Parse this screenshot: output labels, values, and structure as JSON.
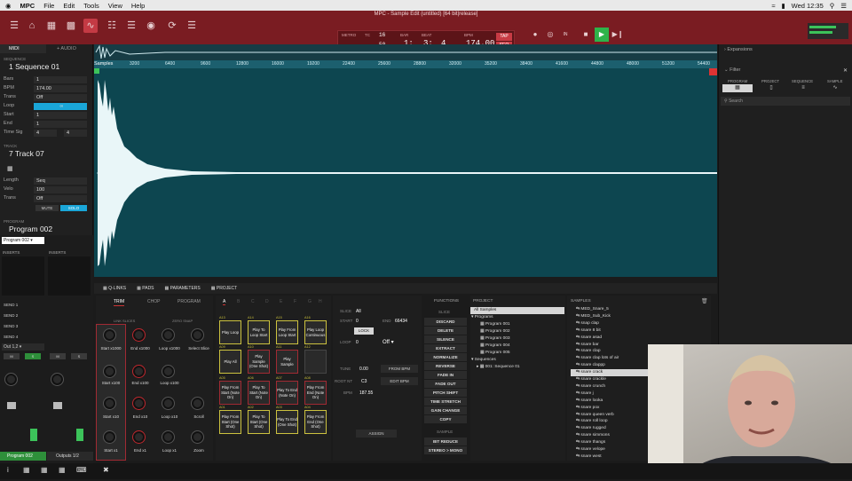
{
  "menubar": {
    "apple": "",
    "app": "MPC",
    "items": [
      "File",
      "Edit",
      "Tools",
      "View",
      "Help"
    ],
    "battery": "▮",
    "clock": "Wed 12:35"
  },
  "window_title": "MPC - Sample Edit (untitled) [64 bit|release]",
  "transport": {
    "metro_label": "METRO",
    "metro_val": "16",
    "tc_label": "TC",
    "tc_val": "16",
    "swing_label": "SWING",
    "swing_val": "50",
    "bar_label": "BAR",
    "bar_val": "1:",
    "beat_label": "BEAT",
    "beat_val": "3:",
    "tick_val": "4",
    "bpm_label": "BPM",
    "bpm_val": "174.00",
    "tap": "TAP",
    "seq": "SEQ",
    "in_label": "IN"
  },
  "left": {
    "midi_tab": "MIDI",
    "audio_tab": "+ AUDIO",
    "sequence_label": "SEQUENCE",
    "sequence_name": "1 Sequence 01",
    "fields": [
      {
        "k": "Bars",
        "v": "1"
      },
      {
        "k": "BPM",
        "v": "174.00"
      },
      {
        "k": "Trans",
        "v": "Off"
      },
      {
        "k": "Loop",
        "v": ""
      },
      {
        "k": "Start",
        "v": "1"
      },
      {
        "k": "End",
        "v": "1"
      },
      {
        "k": "Time Sig",
        "v": "4"
      }
    ],
    "time_sig_den": "4",
    "track_label": "TRACK",
    "track_name": "7 Track 07",
    "track_fields": [
      {
        "k": "Length",
        "v": "Seq"
      },
      {
        "k": "Velo",
        "v": "100"
      },
      {
        "k": "Trans",
        "v": "Off"
      }
    ],
    "mute": "MUTE",
    "solo": "SOLO",
    "program_label": "PROGRAM",
    "program_name": "Program 002",
    "program_select": "Program 002",
    "inserts": "INSERTS",
    "sends": [
      "SEND 1",
      "SEND 2",
      "SEND 3",
      "SEND 4"
    ],
    "out": "Out 1,2",
    "m_label": "M",
    "s_label": "S",
    "program_chip": "Program 002",
    "outputs_chip": "Outputs 1/2"
  },
  "ruler": {
    "first": "Samples",
    "ticks": [
      "3200",
      "6400",
      "9600",
      "12800",
      "16000",
      "19200",
      "22400",
      "25600",
      "28800",
      "32000",
      "35200",
      "38400",
      "41600",
      "44800",
      "48000",
      "51200",
      "54400"
    ]
  },
  "bottom_tabs": [
    "Q-LINKS",
    "PADS",
    "PARAMETERS",
    "PROJECT"
  ],
  "qlinks": {
    "tabs": [
      "TRIM",
      "CHOP",
      "PROGRAM"
    ],
    "link_slices": "LINK SLICES",
    "zero_snap": "ZERO SNAP",
    "knobs": [
      "Start x1000",
      "End x1000",
      "Loop x1000",
      "Select Slice",
      "Start x100",
      "End x100",
      "Loop x100",
      "",
      "Start x10",
      "End x10",
      "Loop x10",
      "Scroll",
      "Start x1",
      "End x1",
      "Loop x1",
      "Zoom"
    ]
  },
  "pads": {
    "banks": [
      "A",
      "B",
      "C",
      "D",
      "E",
      "F",
      "G",
      "H"
    ],
    "items": [
      {
        "n": "A13",
        "t": "Play Loop"
      },
      {
        "n": "A14",
        "t": "Play To Loop Start"
      },
      {
        "n": "A15",
        "t": "Play From Loop Start"
      },
      {
        "n": "A16",
        "t": "Play Loop Continuous"
      },
      {
        "n": "A09",
        "t": "Play All"
      },
      {
        "n": "A10",
        "t": "Play Sample (One Shot)"
      },
      {
        "n": "A11",
        "t": "Play Sample"
      },
      {
        "n": "A12",
        "t": ""
      },
      {
        "n": "A05",
        "t": "Play From Start (Note On)"
      },
      {
        "n": "A06",
        "t": "Play To Start (Note On)"
      },
      {
        "n": "A07",
        "t": "Play To End (Note On)"
      },
      {
        "n": "A08",
        "t": "Play From End (Note On)"
      },
      {
        "n": "A01",
        "t": "Play From Start (One Shot)"
      },
      {
        "n": "A02",
        "t": "Play To Start (One Shot)"
      },
      {
        "n": "A03",
        "t": "Play To End (One Shot)"
      },
      {
        "n": "A04",
        "t": "Play From End (One Shot)"
      }
    ]
  },
  "slice": {
    "slice_label": "SLICE",
    "slice_val": "All",
    "start_label": "START",
    "start_val": "0",
    "end_label": "END",
    "end_val": "66434",
    "lock": "LOCK",
    "loop_label": "LOOP",
    "loop_val": "0",
    "loop_mode": "Off",
    "tune_label": "TUNE",
    "tune_val": "0.00",
    "from_bpm": "FROM BPM",
    "root_label": "ROOT NT",
    "root_val": "C3",
    "edit_bpm": "EDIT BPM",
    "bpm_label": "BPM",
    "bpm_val": "187.55",
    "assign": "ASSIGN"
  },
  "functions": {
    "title": "FUNCTIONS",
    "slice_header": "SLICE",
    "items": [
      "DISCARD",
      "DELETE",
      "SILENCE",
      "EXTRACT",
      "NORMALIZE",
      "REVERSE",
      "FADE IN",
      "FADE OUT",
      "PITCH SHIFT",
      "TIME STRETCH",
      "GAIN CHANGE",
      "COPY"
    ],
    "sample_header": "SAMPLE",
    "sample_items": [
      "BIT REDUCE",
      "STEREO > MONO"
    ]
  },
  "project": {
    "title": "PROJECT",
    "all_samples": "All Samples",
    "programs": "Programs",
    "program_list": [
      "Program 001",
      "Program 002",
      "Program 003",
      "Program 004",
      "Program 005"
    ],
    "sequences": "Sequences",
    "sequence_list": [
      "001: Sequence 01"
    ]
  },
  "samples": {
    "title": "SAMPLES",
    "items": [
      "MED_Snare_5",
      "MED_Sub_Kick",
      "snap clap",
      "snare 8 bit",
      "snare asad",
      "snare bar",
      "snare clap",
      "snare clap lots of air",
      "snare clappp",
      "snare crack",
      "snare crackle",
      "snare crunch",
      "snare j",
      "snare looka",
      "snare pox",
      "snare queen verb",
      "snare roll loop",
      "snare rugged",
      "snare simmons",
      "snare thangs",
      "snare velope",
      "snare west"
    ],
    "selected": "snare crack"
  },
  "right": {
    "expansions": "Expansions",
    "filter": "Filter",
    "tabs": [
      "PROGRAM",
      "PROJECT",
      "SEQUENCE",
      "SAMPLE"
    ],
    "search_placeholder": "Search"
  }
}
